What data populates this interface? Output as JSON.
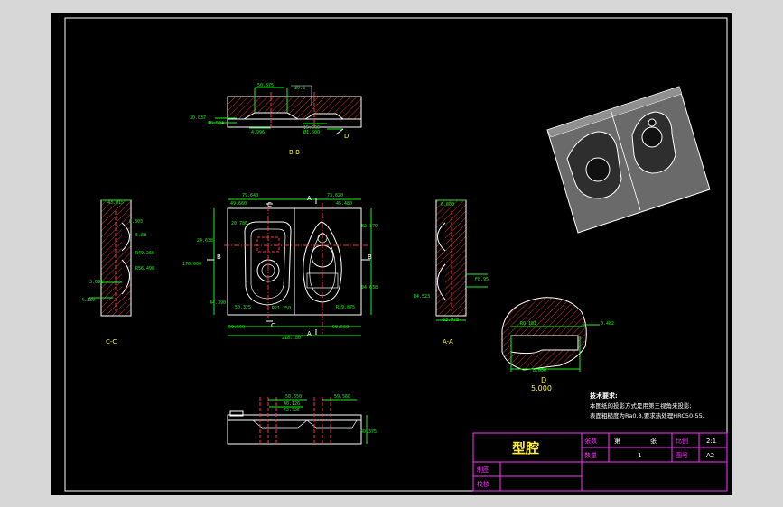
{
  "drawing": {
    "title": "型腔",
    "sheet": {
      "total_label": "张数",
      "current_label": "第",
      "unit": "张"
    },
    "quantity": {
      "label": "数量",
      "value": "1"
    },
    "scale": {
      "label": "比例",
      "value": "2:1"
    },
    "sheet_size": {
      "label": "图号",
      "value": "A2"
    },
    "designer_label": "制图",
    "checker_label": "校核",
    "tech_title": "技术要求:",
    "tech_line1": "本图纸的投影方式是用第三视角来投影;",
    "tech_line2": "表面粗糙度为Ra0.8,要求热处理HRC50-55."
  },
  "views": {
    "bb": "B-B",
    "cc": "C-C",
    "aa": "A-A",
    "d": "D",
    "d_scale": "5.000",
    "section_d": "D"
  },
  "dims": {
    "top": [
      "50.875",
      "39.6",
      "30.037",
      "15.534",
      "4.996",
      "15.566",
      "Ø1.500"
    ],
    "plan": [
      "79.640",
      "73.620",
      "49.660",
      "45.480",
      "20.786",
      "82.379",
      "24.638",
      "170.000",
      "94.638",
      "44.390",
      "50.325",
      "R21.250",
      "R19.875",
      "59.560",
      "59.560",
      "218.180"
    ],
    "cc": [
      "43.015",
      "0.803",
      "5.88",
      "R49.260",
      "R56.498",
      "3.091",
      "4.180"
    ],
    "aa": [
      "6.600",
      "R4.523",
      "33.978",
      "F8.95"
    ],
    "detail": [
      "R0.181",
      "0.482",
      "8.000"
    ],
    "bottom": [
      "50.650",
      "59.560",
      "40.126",
      "42.725",
      "50.375"
    ],
    "letters": [
      "C",
      "C",
      "A",
      "A",
      "B",
      "B"
    ]
  },
  "colors": {
    "frame": "#ffffff",
    "dim": "#22ee22",
    "outline": "#ffffff",
    "hatch": "#ff3333",
    "center": "#ff3333",
    "title_border": "#ff33ff",
    "title_text": "#ffee33",
    "cyan": "#33ddff"
  }
}
